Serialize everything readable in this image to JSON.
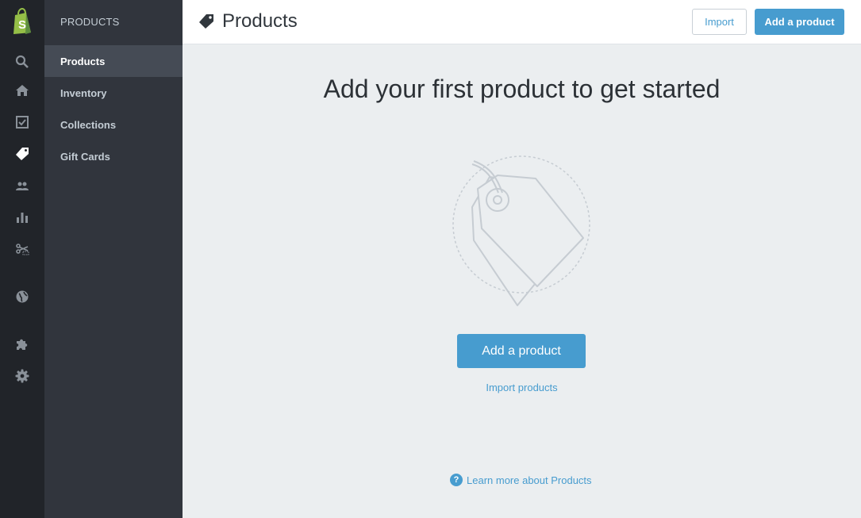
{
  "rail": {
    "icons": [
      "shopify-logo-icon",
      "search-icon",
      "home-icon",
      "orders-icon",
      "products-tag-icon",
      "customers-icon",
      "reports-icon",
      "discounts-icon",
      "online-store-icon",
      "apps-icon",
      "settings-icon"
    ],
    "active": "products-tag-icon"
  },
  "subnav": {
    "heading": "PRODUCTS",
    "items": [
      {
        "label": "Products",
        "active": true
      },
      {
        "label": "Inventory",
        "active": false
      },
      {
        "label": "Collections",
        "active": false
      },
      {
        "label": "Gift Cards",
        "active": false
      }
    ]
  },
  "topbar": {
    "title": "Products",
    "import_label": "Import",
    "add_label": "Add a product"
  },
  "main": {
    "headline": "Add your first product to get started",
    "add_label": "Add a product",
    "import_link": "Import products",
    "learn_more": "Learn more about Products",
    "help_glyph": "?"
  },
  "colors": {
    "accent": "#479ccf",
    "rail_bg": "#212429",
    "subnav_bg": "#31353d",
    "subnav_active": "#454b55",
    "content_bg": "#ebeef0",
    "logo_green": "#95bf47"
  }
}
